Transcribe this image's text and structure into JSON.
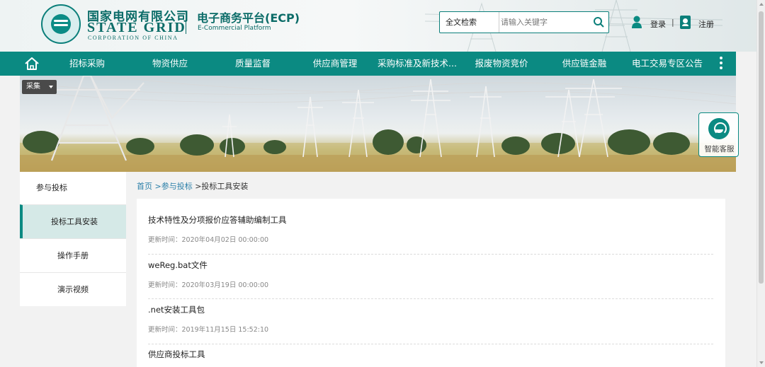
{
  "header": {
    "logo_cn": "国家电网有限公司",
    "logo_en": "STATE GRID",
    "logo_en_sub": "CORPORATION OF CHINA",
    "platform_title": "电子商务平台(ECP)",
    "platform_sub": "E-Commercial Platform",
    "search_scope": "全文检索",
    "search_placeholder": "请输入关键字",
    "login": "登录",
    "separator": "|",
    "register": "注册"
  },
  "nav": {
    "items": [
      {
        "label": "招标采购"
      },
      {
        "label": "物资供应"
      },
      {
        "label": "质量监督"
      },
      {
        "label": "供应商管理"
      },
      {
        "label": "采购标准及新技术..."
      },
      {
        "label": "报废物资竞价"
      },
      {
        "label": "供应链金融"
      },
      {
        "label": "电工交易专区公告"
      }
    ]
  },
  "banner": {
    "collect_label": "采集",
    "service_label": "智能客服"
  },
  "sidebar": {
    "head": "参与投标",
    "items": [
      {
        "label": "投标工具安装"
      },
      {
        "label": "操作手册"
      },
      {
        "label": "演示视频"
      }
    ]
  },
  "breadcrumb": {
    "home": "首页",
    "parent": ">参与投标",
    "current": ">投标工具安装"
  },
  "list": {
    "entries": [
      {
        "title": "技术特性及分项报价应答辅助编制工具",
        "time": "更新时间：2020年04月02日 00:00:00"
      },
      {
        "title": "weReg.bat文件",
        "time": "更新时间：2020年03月19日 00:00:00"
      },
      {
        "title": ".net安装工具包",
        "time": "更新时间：2019年11月15日 15:52:10"
      },
      {
        "title": "供应商投标工具",
        "time": ""
      }
    ]
  },
  "colors": {
    "brand": "#0b8a82",
    "link": "#2a7fa8"
  }
}
